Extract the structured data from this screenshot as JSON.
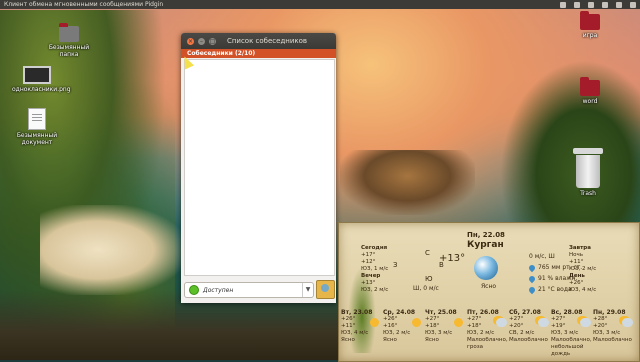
{
  "panel": {
    "app_title": "Клиент обмена мгновенными сообщениями Pidgin"
  },
  "desktop": {
    "icons": [
      {
        "label": "Безымянный папка"
      },
      {
        "label": "однокласники.png"
      },
      {
        "label": "Безымянный документ"
      },
      {
        "label": "игра"
      },
      {
        "label": "word"
      },
      {
        "label": "Trash"
      }
    ]
  },
  "window": {
    "title": "Список собеседников",
    "group_label": "Собеседники (2/10)",
    "status": {
      "label": "Доступен",
      "color": "#5bbf27"
    },
    "accent_color": "#d25127"
  },
  "weather": {
    "current": {
      "day": "Пн, 22.08",
      "city": "Курган",
      "temp": "+13°",
      "condition": "Ясно",
      "wind_dir": "Ш, 0 м/с",
      "arrow_top": "С",
      "arrow_bottom": "Ю",
      "label_z": "З",
      "label_v": "В"
    },
    "details": [
      "0 м/с, Ш",
      "765 мм рт. ст.",
      "91 % влажн.",
      "21 °C вода"
    ],
    "today": {
      "name": "Сегодня",
      "lines": [
        "+17°",
        "+12°",
        "ЮЗ, 1 м/с"
      ],
      "extra": [
        "Вечер",
        "+13°",
        "ЮЗ, 2 м/с"
      ]
    },
    "tomorrow": {
      "name": "Завтра",
      "lines": [
        "Ночь",
        "+11°",
        "ЮЗ, 2 м/с"
      ],
      "extra": [
        "День",
        "+26°",
        "ЮЗ, 4 м/с"
      ]
    },
    "forecast": [
      {
        "day": "Вт, 23.08",
        "hi": "+26°",
        "lo": "+11°",
        "wind": "ЮЗ, 4 м/с",
        "cond": "Ясно"
      },
      {
        "day": "Ср, 24.08",
        "hi": "+26°",
        "lo": "+16°",
        "wind": "ЮЗ, 2 м/с",
        "cond": "Ясно"
      },
      {
        "day": "Чт, 25.08",
        "hi": "+27°",
        "lo": "+18°",
        "wind": "ЮЗ, 3 м/с",
        "cond": "Ясно"
      },
      {
        "day": "Пт, 26.08",
        "hi": "+27°",
        "lo": "+18°",
        "wind": "ЮЗ, 2 м/с",
        "cond": "Малооблачно, гроза"
      },
      {
        "day": "Сб, 27.08",
        "hi": "+27°",
        "lo": "+20°",
        "wind": "СВ, 2 м/с",
        "cond": "Малооблачно"
      },
      {
        "day": "Вс, 28.08",
        "hi": "+27°",
        "lo": "+19°",
        "wind": "ЮЗ, 3 м/с",
        "cond": "Малооблачно, небольшой дождь"
      },
      {
        "day": "Пн, 29.08",
        "hi": "+28°",
        "lo": "+20°",
        "wind": "ЮЗ, 3 м/с",
        "cond": "Малооблачно"
      }
    ]
  }
}
